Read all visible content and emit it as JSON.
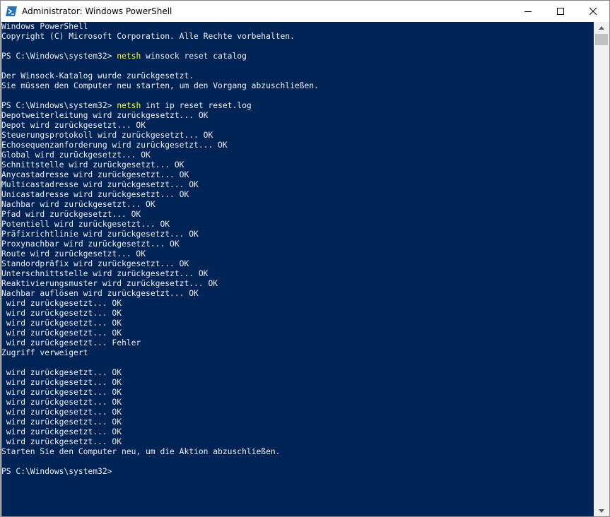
{
  "window": {
    "title": "Administrator: Windows PowerShell",
    "controls": {
      "minimize": "minimize-icon",
      "maximize": "maximize-icon",
      "close": "close-icon"
    }
  },
  "colors": {
    "console_background": "#012456",
    "console_text": "#eeedf0",
    "command_text": "#ffff00"
  },
  "console": {
    "lines": [
      {
        "text": "Windows PowerShell"
      },
      {
        "text": "Copyright (C) Microsoft Corporation. Alle Rechte vorbehalten."
      },
      {
        "text": ""
      },
      {
        "prompt": "PS C:\\Windows\\system32> ",
        "command": "netsh",
        "args": " winsock reset catalog"
      },
      {
        "text": ""
      },
      {
        "text": "Der Winsock-Katalog wurde zurückgesetzt."
      },
      {
        "text": "Sie müssen den Computer neu starten, um den Vorgang abzuschließen."
      },
      {
        "text": ""
      },
      {
        "prompt": "PS C:\\Windows\\system32> ",
        "command": "netsh",
        "args": " int ip reset reset.log"
      },
      {
        "text": "Depotweiterleitung wird zurückgesetzt... OK"
      },
      {
        "text": "Depot wird zurückgesetzt... OK"
      },
      {
        "text": "Steuerungsprotokoll wird zurückgesetzt... OK"
      },
      {
        "text": "Echosequenzanforderung wird zurückgesetzt... OK"
      },
      {
        "text": "Global wird zurückgesetzt... OK"
      },
      {
        "text": "Schnittstelle wird zurückgesetzt... OK"
      },
      {
        "text": "Anycastadresse wird zurückgesetzt... OK"
      },
      {
        "text": "Multicastadresse wird zurückgesetzt... OK"
      },
      {
        "text": "Unicastadresse wird zurückgesetzt... OK"
      },
      {
        "text": "Nachbar wird zurückgesetzt... OK"
      },
      {
        "text": "Pfad wird zurückgesetzt... OK"
      },
      {
        "text": "Potentiell wird zurückgesetzt... OK"
      },
      {
        "text": "Präfixrichtlinie wird zurückgesetzt... OK"
      },
      {
        "text": "Proxynachbar wird zurückgesetzt... OK"
      },
      {
        "text": "Route wird zurückgesetzt... OK"
      },
      {
        "text": "Standordpräfix wird zurückgesetzt... OK"
      },
      {
        "text": "Unterschnittstelle wird zurückgesetzt... OK"
      },
      {
        "text": "Reaktivierungsmuster wird zurückgesetzt... OK"
      },
      {
        "text": "Nachbar auflösen wird zurückgesetzt... OK"
      },
      {
        "text": " wird zurückgesetzt... OK"
      },
      {
        "text": " wird zurückgesetzt... OK"
      },
      {
        "text": " wird zurückgesetzt... OK"
      },
      {
        "text": " wird zurückgesetzt... OK"
      },
      {
        "text": " wird zurückgesetzt... Fehler"
      },
      {
        "text": "Zugriff verweigert"
      },
      {
        "text": ""
      },
      {
        "text": " wird zurückgesetzt... OK"
      },
      {
        "text": " wird zurückgesetzt... OK"
      },
      {
        "text": " wird zurückgesetzt... OK"
      },
      {
        "text": " wird zurückgesetzt... OK"
      },
      {
        "text": " wird zurückgesetzt... OK"
      },
      {
        "text": " wird zurückgesetzt... OK"
      },
      {
        "text": " wird zurückgesetzt... OK"
      },
      {
        "text": " wird zurückgesetzt... OK"
      },
      {
        "text": "Starten Sie den Computer neu, um die Aktion abzuschließen."
      },
      {
        "text": ""
      },
      {
        "prompt": "PS C:\\Windows\\system32> ",
        "command": "",
        "args": ""
      }
    ]
  },
  "scrollbar": {
    "up_arrow": "chevron-up-icon",
    "down_arrow": "chevron-down-icon"
  }
}
